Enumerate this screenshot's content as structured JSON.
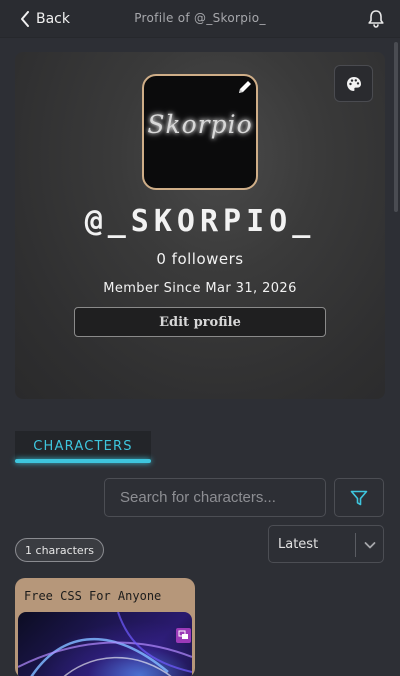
{
  "topbar": {
    "back_label": "Back",
    "title": "Profile of @_Skorpio_"
  },
  "profile": {
    "avatar_logo_text": "Skorpio",
    "username": "@_SKORPIO_",
    "followers": "0 followers",
    "member_since": "Member Since Mar 31, 2026",
    "edit_label": "Edit profile"
  },
  "tabs": [
    {
      "label": "CHARACTERS",
      "active": true
    }
  ],
  "search": {
    "placeholder": "Search for characters..."
  },
  "sort": {
    "selected": "Latest"
  },
  "count_label": "1 characters",
  "characters": [
    {
      "title": "Free CSS For Anyone"
    }
  ],
  "colors": {
    "accent": "#3ec6de",
    "avatar_border": "#cfae88",
    "card_bg": "#b6977a",
    "page_bg": "#2d2f35"
  },
  "icons": {
    "back": "chevron-left-icon",
    "notifications": "bell-icon",
    "theme": "palette-icon",
    "edit_avatar": "pencil-icon",
    "filter": "filter-icon",
    "sort": "chevron-down-icon",
    "character_badge": "chat-bubble-icon"
  }
}
